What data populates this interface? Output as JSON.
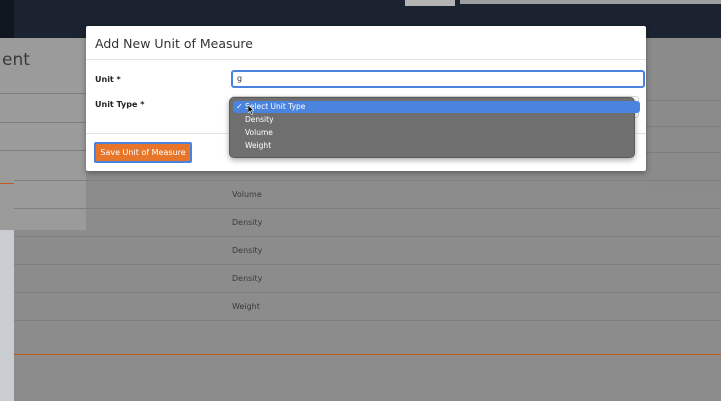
{
  "background": {
    "heading_fragment": "ent",
    "rows": [
      "Volume",
      "Density",
      "Density",
      "Density",
      "Weight"
    ]
  },
  "modal": {
    "title": "Add New Unit of Measure",
    "unit_label": "Unit *",
    "unit_value": "g",
    "unit_type_label": "Unit Type *",
    "save_label": "Save Unit of Measure"
  },
  "dropdown": {
    "options": [
      "Select Unit Type",
      "Density",
      "Volume",
      "Weight"
    ],
    "selected": "Select Unit Type",
    "check_glyph": "✓"
  },
  "colors": {
    "accent_blue": "#4a82e0",
    "save_orange": "#e8762a"
  }
}
